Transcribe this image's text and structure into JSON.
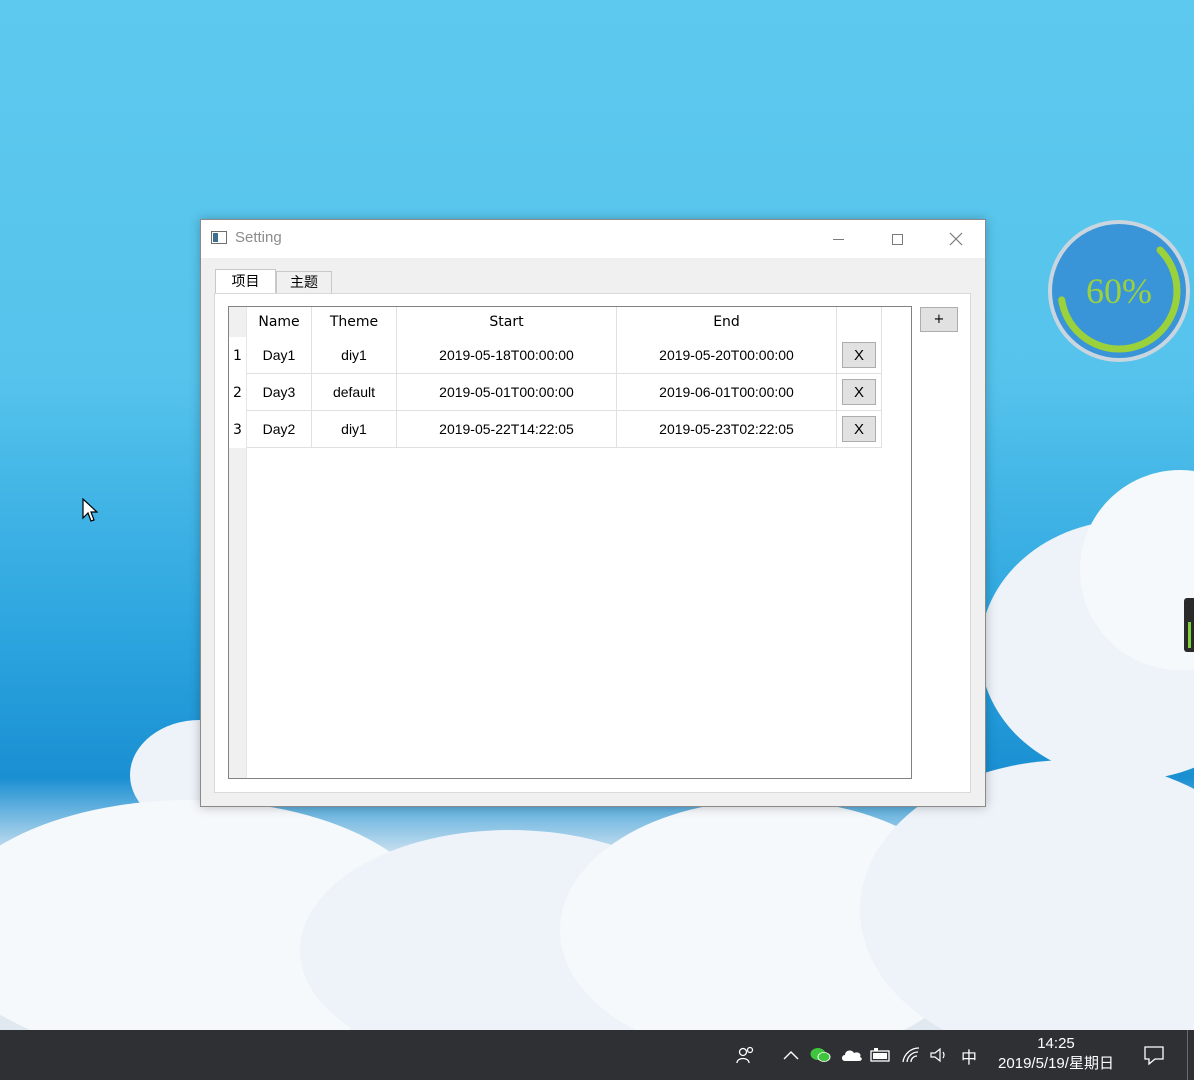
{
  "window": {
    "title": "Setting",
    "controls": {
      "minimize": "minimize",
      "maximize": "maximize",
      "close": "close"
    }
  },
  "tabs": [
    {
      "label": "项目",
      "active": true
    },
    {
      "label": "主题",
      "active": false
    }
  ],
  "table": {
    "columns": [
      "Name",
      "Theme",
      "Start",
      "End",
      ""
    ],
    "rows": [
      {
        "index": "1",
        "name": "Day1",
        "theme": "diy1",
        "start": "2019-05-18T00:00:00",
        "end": "2019-05-20T00:00:00",
        "delete": "X"
      },
      {
        "index": "2",
        "name": "Day3",
        "theme": "default",
        "start": "2019-05-01T00:00:00",
        "end": "2019-06-01T00:00:00",
        "delete": "X"
      },
      {
        "index": "3",
        "name": "Day2",
        "theme": "diy1",
        "start": "2019-05-22T14:22:05",
        "end": "2019-05-23T02:22:05",
        "delete": "X"
      }
    ],
    "add_label": "+"
  },
  "gauge": {
    "label": "60%",
    "value": 0.6,
    "ring_color": "#9bd23c",
    "fill_color": "#3a94d8"
  },
  "taskbar": {
    "ime": "中",
    "time": "14:25",
    "date": "2019/5/19/星期日",
    "icons": [
      "people-icon",
      "chevron-up-icon",
      "wechat-icon",
      "onedrive-icon",
      "battery-icon",
      "wifi-icon",
      "volume-icon",
      "notification-icon"
    ]
  }
}
